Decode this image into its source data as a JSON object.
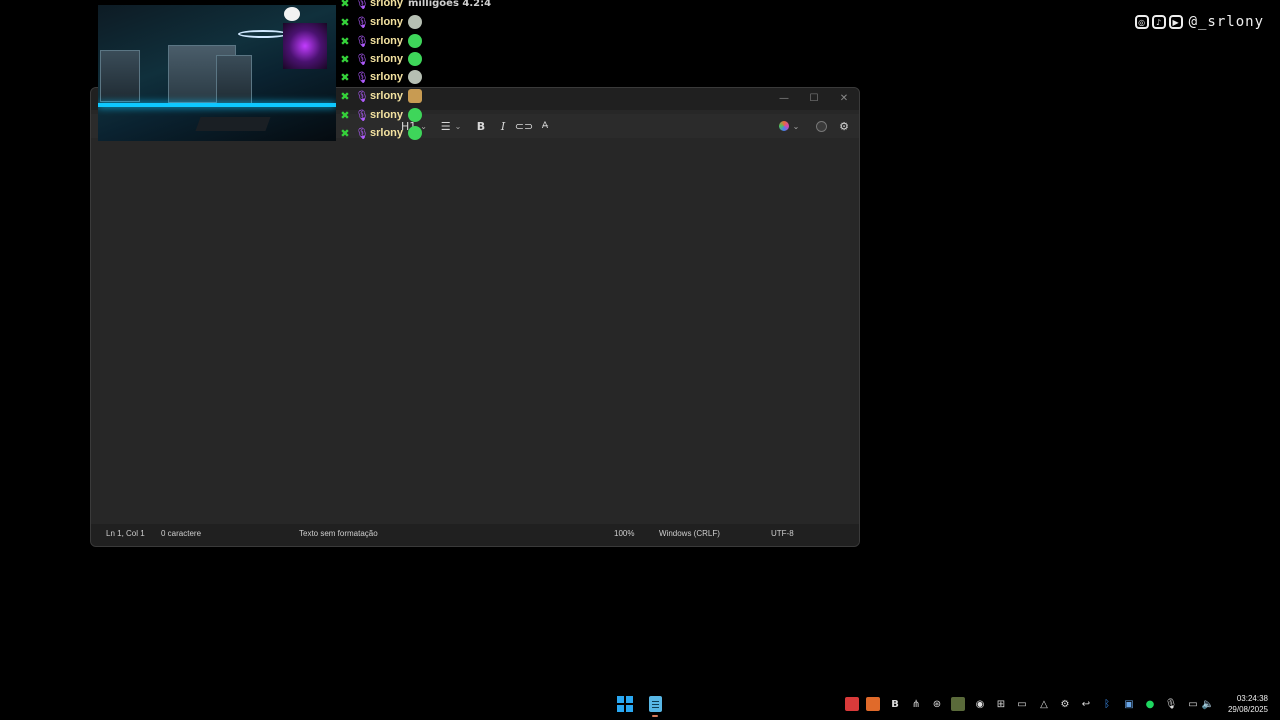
{
  "overlay": {
    "social_handle": "@_srlony",
    "social_icons": [
      "instagram-icon",
      "tiktok-icon",
      "youtube-icon"
    ],
    "chat": {
      "username": "srlony",
      "top_message": "milligoes 4.2:4",
      "colors": {
        "username": "#f3e2a0",
        "mod_badge": "#35d23a",
        "mic_badge": "#b15cff"
      }
    }
  },
  "notepad": {
    "toolbar": {
      "heading_label": "H1",
      "items": [
        "heading-dropdown",
        "list-dropdown",
        "bold",
        "italic",
        "link",
        "clear-formatting",
        "copilot",
        "account",
        "settings"
      ]
    },
    "window_controls": {
      "minimize": "—",
      "maximize": "☐",
      "close": "✕"
    },
    "status": {
      "position": "Ln 1, Col 1",
      "chars": "0 caractere",
      "format": "Texto sem formatação",
      "zoom": "100%",
      "line_ending": "Windows (CRLF)",
      "encoding": "UTF-8"
    }
  },
  "taskbar": {
    "clock_time": "03:24:38",
    "clock_date": "29/08/2025",
    "accent": "#2aa8f2"
  }
}
